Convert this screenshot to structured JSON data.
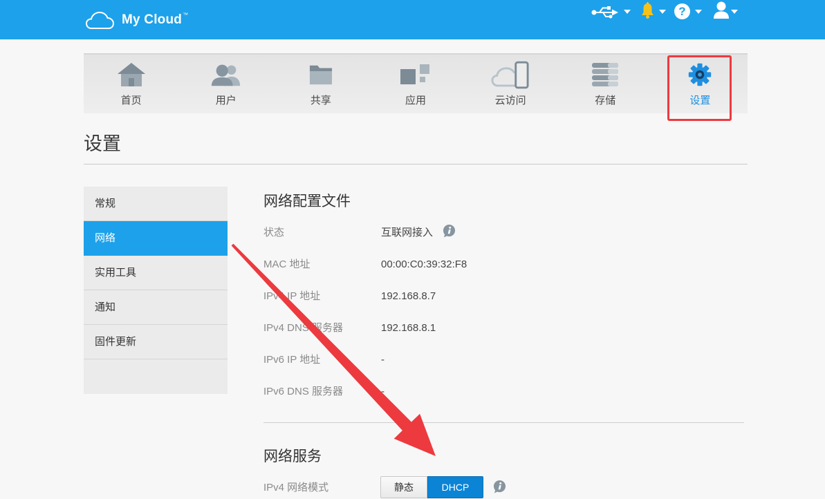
{
  "app": {
    "brand": "My Cloud",
    "trademark": "™"
  },
  "header": {
    "icons": [
      {
        "name": "usb-icon",
        "has_dropdown": true
      },
      {
        "name": "bell-icon",
        "has_dropdown": true
      },
      {
        "name": "help-icon",
        "glyph": "?",
        "has_dropdown": true
      },
      {
        "name": "user-icon",
        "has_dropdown": true
      }
    ]
  },
  "nav": {
    "items": [
      {
        "label": "首页",
        "icon": "home-icon"
      },
      {
        "label": "用户",
        "icon": "users-icon"
      },
      {
        "label": "共享",
        "icon": "folder-icon"
      },
      {
        "label": "应用",
        "icon": "apps-icon"
      },
      {
        "label": "云访问",
        "icon": "cloud-access-icon"
      },
      {
        "label": "存储",
        "icon": "storage-icon"
      },
      {
        "label": "设置",
        "icon": "gear-icon",
        "active": true
      }
    ]
  },
  "page": {
    "title": "设置"
  },
  "sidebar": {
    "items": [
      {
        "label": "常规"
      },
      {
        "label": "网络",
        "active": true
      },
      {
        "label": "实用工具"
      },
      {
        "label": "通知"
      },
      {
        "label": "固件更新"
      }
    ]
  },
  "network_profile": {
    "heading": "网络配置文件",
    "rows": [
      {
        "label": "状态",
        "value": "互联网接入",
        "info_icon": true
      },
      {
        "label": "MAC 地址",
        "value": "00:00:C0:39:32:F8"
      },
      {
        "label": "IPv4 IP 地址",
        "value": "192.168.8.7"
      },
      {
        "label": "IPv4 DNS 服务器",
        "value": "192.168.8.1"
      },
      {
        "label": "IPv6 IP 地址",
        "value": "-"
      },
      {
        "label": "IPv6 DNS 服务器",
        "value": "-"
      }
    ]
  },
  "network_services": {
    "heading": "网络服务",
    "ipv4_mode": {
      "label": "IPv4 网络模式",
      "options": [
        "静态",
        "DHCP"
      ],
      "selected_index": 1,
      "info_icon": true
    }
  },
  "colors": {
    "header_bg": "#1da1ea",
    "accent": "#1da1ea",
    "active_toggle": "#0b84d6",
    "bell": "#f5c21b",
    "icon_gray": "#8795a0",
    "annotation_red": "#ec3a3f",
    "active_nav_text": "#1d8fe0"
  }
}
